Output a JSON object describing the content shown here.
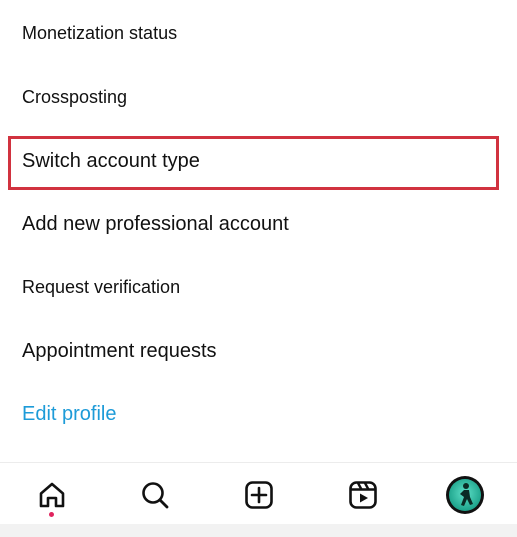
{
  "menu": {
    "items": [
      {
        "label": "Monetization status"
      },
      {
        "label": "Crossposting"
      },
      {
        "label": "Switch account type",
        "highlighted": true
      },
      {
        "label": "Add new professional account"
      },
      {
        "label": "Request verification"
      },
      {
        "label": "Appointment requests"
      },
      {
        "label": "Edit profile",
        "style": "link"
      }
    ]
  },
  "colors": {
    "link": "#1d9bd8",
    "highlight_border": "#d1323f",
    "notification_dot": "#e0245e",
    "avatar_accent": "#1fa58d"
  },
  "bottom_nav": {
    "items": [
      {
        "icon": "home-icon",
        "active": true,
        "has_notification_dot": true
      },
      {
        "icon": "search-icon"
      },
      {
        "icon": "create-icon"
      },
      {
        "icon": "reels-icon"
      },
      {
        "icon": "profile-avatar"
      }
    ]
  }
}
